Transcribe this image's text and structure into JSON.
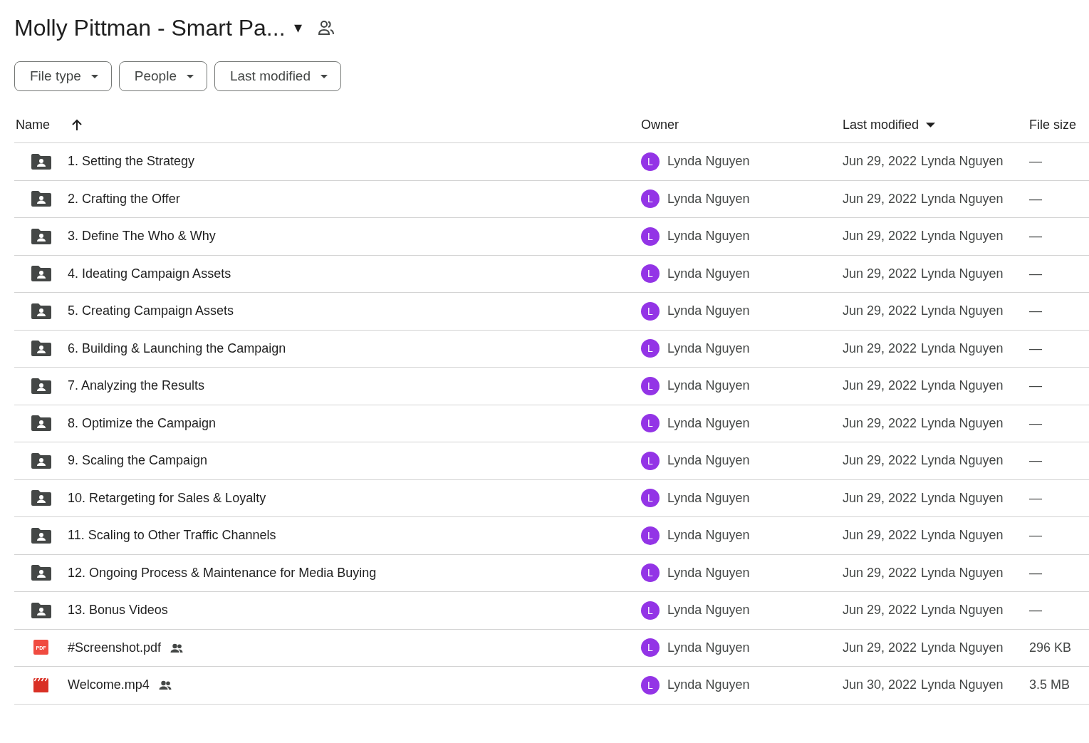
{
  "header": {
    "title": "Molly Pittman - Smart Pa...",
    "title_caret": "▾"
  },
  "filters": [
    {
      "label": "File type"
    },
    {
      "label": "People"
    },
    {
      "label": "Last modified"
    }
  ],
  "table": {
    "columns": [
      {
        "label": "Name",
        "kind": "sortup"
      },
      {
        "label": "Owner",
        "kind": "plain"
      },
      {
        "label": "Last modified",
        "kind": "sortdown"
      },
      {
        "label": "File size",
        "kind": "plain"
      }
    ],
    "rows": [
      {
        "kind": "folder",
        "name": "1. Setting the Strategy",
        "shared": false,
        "owner": "Lynda Nguyen",
        "owner_initial": "L",
        "color": "#9334e6",
        "modified": "Jun 29, 2022",
        "modified_by": "Lynda Nguyen",
        "size": "—"
      },
      {
        "kind": "folder",
        "name": "2. Crafting the Offer",
        "shared": false,
        "owner": "Lynda Nguyen",
        "owner_initial": "L",
        "color": "#9334e6",
        "modified": "Jun 29, 2022",
        "modified_by": "Lynda Nguyen",
        "size": "—"
      },
      {
        "kind": "folder",
        "name": "3. Define The Who & Why",
        "shared": false,
        "owner": "Lynda Nguyen",
        "owner_initial": "L",
        "color": "#9334e6",
        "modified": "Jun 29, 2022",
        "modified_by": "Lynda Nguyen",
        "size": "—"
      },
      {
        "kind": "folder",
        "name": "4. Ideating Campaign Assets",
        "shared": false,
        "owner": "Lynda Nguyen",
        "owner_initial": "L",
        "color": "#9334e6",
        "modified": "Jun 29, 2022",
        "modified_by": "Lynda Nguyen",
        "size": "—"
      },
      {
        "kind": "folder",
        "name": "5. Creating Campaign Assets",
        "shared": false,
        "owner": "Lynda Nguyen",
        "owner_initial": "L",
        "color": "#9334e6",
        "modified": "Jun 29, 2022",
        "modified_by": "Lynda Nguyen",
        "size": "—"
      },
      {
        "kind": "folder",
        "name": "6. Building & Launching the Campaign",
        "shared": false,
        "owner": "Lynda Nguyen",
        "owner_initial": "L",
        "color": "#9334e6",
        "modified": "Jun 29, 2022",
        "modified_by": "Lynda Nguyen",
        "size": "—"
      },
      {
        "kind": "folder",
        "name": "7. Analyzing the Results",
        "shared": false,
        "owner": "Lynda Nguyen",
        "owner_initial": "L",
        "color": "#9334e6",
        "modified": "Jun 29, 2022",
        "modified_by": "Lynda Nguyen",
        "size": "—"
      },
      {
        "kind": "folder",
        "name": "8. Optimize the Campaign",
        "shared": false,
        "owner": "Lynda Nguyen",
        "owner_initial": "L",
        "color": "#9334e6",
        "modified": "Jun 29, 2022",
        "modified_by": "Lynda Nguyen",
        "size": "—"
      },
      {
        "kind": "folder",
        "name": "9. Scaling the Campaign",
        "shared": false,
        "owner": "Lynda Nguyen",
        "owner_initial": "L",
        "color": "#9334e6",
        "modified": "Jun 29, 2022",
        "modified_by": "Lynda Nguyen",
        "size": "—"
      },
      {
        "kind": "folder",
        "name": "10. Retargeting for Sales & Loyalty",
        "shared": false,
        "owner": "Lynda Nguyen",
        "owner_initial": "L",
        "color": "#9334e6",
        "modified": "Jun 29, 2022",
        "modified_by": "Lynda Nguyen",
        "size": "—"
      },
      {
        "kind": "folder",
        "name": "11. Scaling to Other Traffic Channels",
        "shared": false,
        "owner": "Lynda Nguyen",
        "owner_initial": "L",
        "color": "#9334e6",
        "modified": "Jun 29, 2022",
        "modified_by": "Lynda Nguyen",
        "size": "—"
      },
      {
        "kind": "folder",
        "name": "12. Ongoing Process & Maintenance for Media Buying",
        "shared": false,
        "owner": "Lynda Nguyen",
        "owner_initial": "L",
        "color": "#9334e6",
        "modified": "Jun 29, 2022",
        "modified_by": "Lynda Nguyen",
        "size": "—"
      },
      {
        "kind": "folder",
        "name": "13. Bonus Videos",
        "shared": false,
        "owner": "Lynda Nguyen",
        "owner_initial": "L",
        "color": "#9334e6",
        "modified": "Jun 29, 2022",
        "modified_by": "Lynda Nguyen",
        "size": "—"
      },
      {
        "kind": "pdf",
        "icon_label": "PDF",
        "name": "#Screenshot.pdf",
        "shared": true,
        "owner": "Lynda Nguyen",
        "owner_initial": "L",
        "color": "#9334e6",
        "modified": "Jun 29, 2022",
        "modified_by": "Lynda Nguyen",
        "size": "296 KB"
      },
      {
        "kind": "video",
        "name": "Welcome.mp4",
        "shared": true,
        "owner": "Lynda Nguyen",
        "owner_initial": "L",
        "color": "#9334e6",
        "modified": "Jun 30, 2022",
        "modified_by": "Lynda Nguyen",
        "size": "3.5 MB"
      }
    ]
  }
}
